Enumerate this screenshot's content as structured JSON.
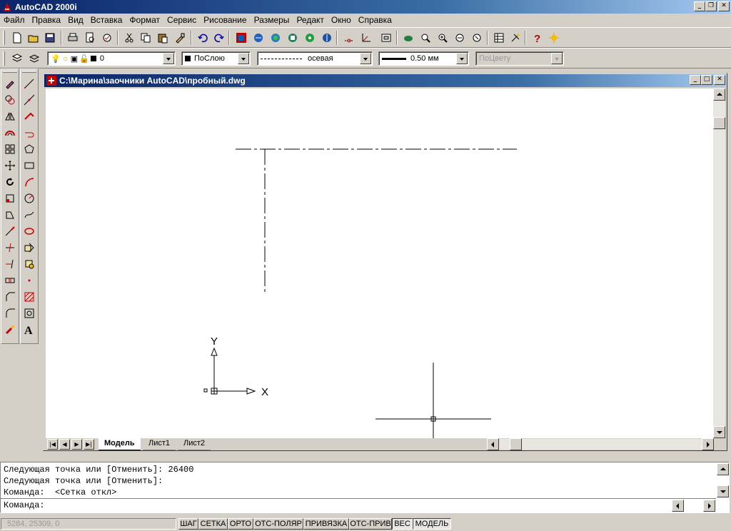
{
  "window": {
    "title": "AutoCAD 2000i",
    "controls": [
      "_",
      "❐",
      "✕"
    ]
  },
  "menu": [
    "Файл",
    "Правка",
    "Вид",
    "Вставка",
    "Формат",
    "Сервис",
    "Рисование",
    "Размеры",
    "Редакт",
    "Окно",
    "Справка"
  ],
  "layer_toolbar": {
    "layer": "0",
    "color": "ПоСлою",
    "linetype": "осевая",
    "lineweight": "0.50 мм",
    "plotstyle": "ПоЦвету"
  },
  "document": {
    "title": "C:\\Марина\\заочники AutoCAD\\пробный.dwg",
    "ucs": {
      "x_label": "X",
      "y_label": "Y"
    },
    "tabs": [
      "Модель",
      "Лист1",
      "Лист2"
    ],
    "active_tab": "Модель"
  },
  "command": {
    "history": [
      "Следующая точка или [Отменить]: 26400",
      "Следующая точка или [Отменить]:",
      "Команда:  <Сетка откл>"
    ],
    "prompt": "Команда:"
  },
  "status": {
    "coordinates": "5284, 25309, 0",
    "buttons": [
      "ШАГ",
      "СЕТКА",
      "ОРТО",
      "ОТС-ПОЛЯР",
      "ПРИВЯЗКА",
      "ОТС-ПРИВ",
      "ВЕС",
      "МОДЕЛЬ"
    ],
    "pressed": [
      "ВЕС",
      "МОДЕЛЬ"
    ]
  },
  "colors": {
    "title_start": "#0a246a",
    "title_end": "#a6caf0",
    "chrome": "#d4d0c8",
    "canvas": "#ffffff"
  }
}
